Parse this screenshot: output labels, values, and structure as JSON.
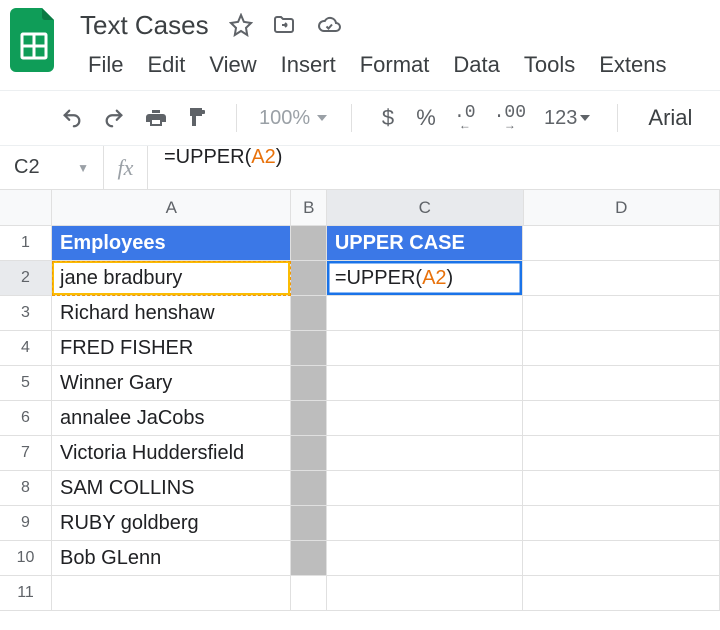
{
  "doc": {
    "title": "Text Cases"
  },
  "menu": {
    "file": "File",
    "edit": "Edit",
    "view": "View",
    "insert": "Insert",
    "format": "Format",
    "data": "Data",
    "tools": "Tools",
    "extensions": "Extens"
  },
  "toolbar": {
    "zoom": "100%",
    "currency": "$",
    "percent": "%",
    "dec_less": ".0",
    "dec_more": ".00",
    "num_format": "123",
    "font": "Arial"
  },
  "fx": {
    "name_box": "C2",
    "label": "fx",
    "formula_prefix": "=UPPER(",
    "formula_ref": "A2",
    "formula_suffix": ")"
  },
  "columns": [
    "A",
    "B",
    "C",
    "D"
  ],
  "rows": [
    "1",
    "2",
    "3",
    "4",
    "5",
    "6",
    "7",
    "8",
    "9",
    "10",
    "11"
  ],
  "headers": {
    "A": "Employees",
    "C": "UPPER CASE"
  },
  "colA": [
    "jane bradbury",
    "Richard henshaw",
    "FRED FISHER",
    "Winner Gary",
    "annalee JaCobs",
    "Victoria Huddersfield",
    "SAM COLLINS",
    "RUBY goldberg",
    "Bob GLenn"
  ],
  "active_cell": {
    "formula_prefix": "=UPPER(",
    "formula_ref": "A2",
    "formula_suffix": ")"
  }
}
